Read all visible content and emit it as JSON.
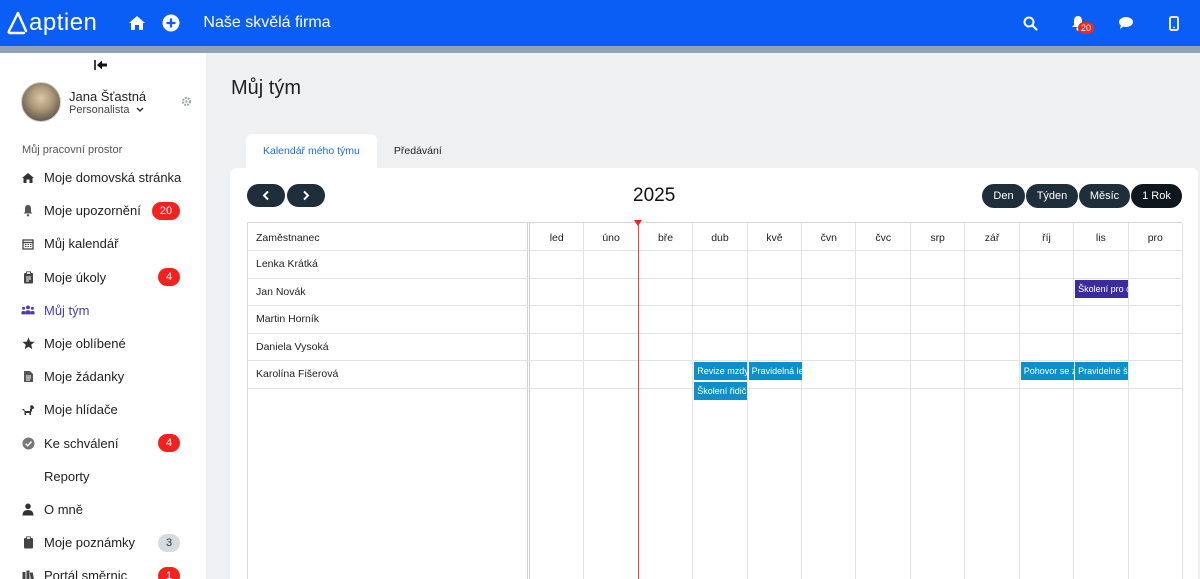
{
  "topbar": {
    "logo_text": "aptien",
    "company": "Naše skvělá firma",
    "notifications_count": "20",
    "bg_color": "#0a5ef5"
  },
  "sidebar": {
    "user_name": "Jana Šťastná",
    "user_role": "Personalista",
    "workspace_title": "Můj pracovní prostor",
    "items": [
      {
        "label": "Moje domovská stránka",
        "icon": "home-icon",
        "badge": ""
      },
      {
        "label": "Moje upozornění",
        "icon": "bell-icon",
        "badge": "20"
      },
      {
        "label": "Můj kalendář",
        "icon": "calendar-icon",
        "badge": ""
      },
      {
        "label": "Moje úkoly",
        "icon": "clipboard-icon",
        "badge": "4"
      },
      {
        "label": "Můj tým",
        "icon": "team-icon",
        "badge": ""
      },
      {
        "label": "Moje oblíbené",
        "icon": "star-icon",
        "badge": ""
      },
      {
        "label": "Moje žádanky",
        "icon": "document-icon",
        "badge": ""
      },
      {
        "label": "Moje hlídače",
        "icon": "dog-icon",
        "badge": ""
      },
      {
        "label": "Ke schválení",
        "icon": "check-circle-icon",
        "badge": "4"
      },
      {
        "label": "Reporty",
        "icon": "",
        "badge": ""
      },
      {
        "label": "O mně",
        "icon": "user-icon",
        "badge": ""
      },
      {
        "label": "Moje poznámky",
        "icon": "note-icon",
        "badge": "3"
      },
      {
        "label": "Portál směrnic",
        "icon": "books-icon",
        "badge": "1"
      }
    ]
  },
  "main": {
    "title": "Můj tým",
    "tabs": [
      {
        "label": "Kalendář mého týmu",
        "active": true
      },
      {
        "label": "Předávání",
        "active": false
      }
    ],
    "year": "2025",
    "views": [
      "Den",
      "Týden",
      "Měsíc",
      "1 Rok"
    ],
    "active_view": "1 Rok",
    "employee_header": "Zaměstnanec",
    "months": [
      "led",
      "úno",
      "bře",
      "dub",
      "kvě",
      "čvn",
      "čvc",
      "srp",
      "zář",
      "říj",
      "lis",
      "pro"
    ],
    "employees": [
      "Lenka Krátká",
      "Jan Novák",
      "Martin Horník",
      "Daniela Vysoká",
      "Karolína Fišerová"
    ],
    "events": [
      {
        "label": "Školení pro d",
        "employee_index": 1,
        "month_index": 10,
        "lane": 0,
        "color": "#3b2c9e"
      },
      {
        "label": "Revize mzdy",
        "employee_index": 4,
        "month_index": 3,
        "lane": 0,
        "color": "#0f8fc9"
      },
      {
        "label": "Pravidelná le",
        "employee_index": 4,
        "month_index": 4,
        "lane": 0,
        "color": "#0f8fc9"
      },
      {
        "label": "Školení řidič",
        "employee_index": 4,
        "month_index": 3,
        "lane": 1,
        "color": "#0f8fc9"
      },
      {
        "label": "Pohovor se z",
        "employee_index": 4,
        "month_index": 9,
        "lane": 0,
        "color": "#0f8fc9"
      },
      {
        "label": "Pravidelné š",
        "employee_index": 4,
        "month_index": 10,
        "lane": 0,
        "color": "#0f8fc9"
      }
    ]
  }
}
